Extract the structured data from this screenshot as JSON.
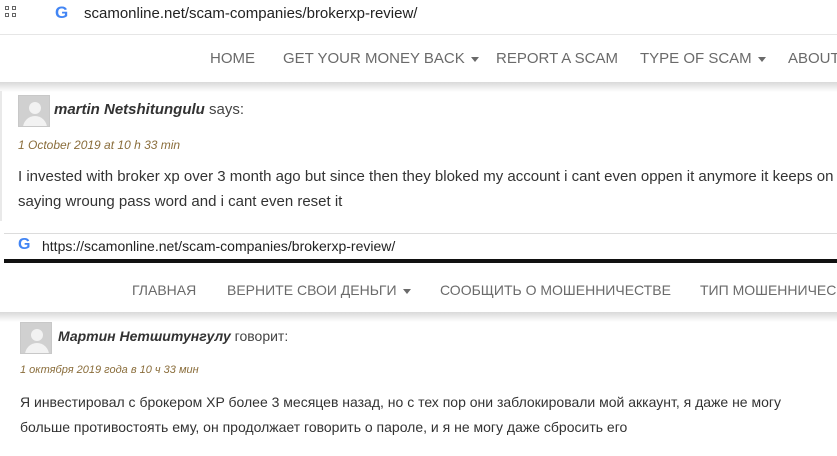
{
  "top": {
    "url": "scamonline.net/scam-companies/brokerxp-review/",
    "nav": [
      "HOME",
      "GET YOUR MONEY BACK",
      "REPORT A SCAM",
      "TYPE OF SCAM",
      "ABOUT"
    ],
    "comment": {
      "author": "martin Netshitungulu",
      "says": " says:",
      "date": "1 October 2019 at 10 h 33 min",
      "line1": "I invested with broker xp over 3 month ago but since then they bloked my account i cant even oppen it anymore it keeps on",
      "line2": "saying wroung pass word and i cant even reset it"
    }
  },
  "bottom": {
    "url": "https://scamonline.net/scam-companies/brokerxp-review/",
    "nav": [
      "ГЛАВНАЯ",
      "ВЕРНИТЕ СВОИ ДЕНЬГИ",
      "СООБЩИТЬ О МОШЕННИЧЕСТВЕ",
      "ТИП МОШЕННИЧЕС"
    ],
    "comment": {
      "author": "Мартин Нетшитунгулу",
      "says": " говорит:",
      "date": "1 октября 2019 года в 10 ч 33 мин",
      "line1": "Я инвестировал с брокером XP более 3 месяцев назад, но с тех пор они заблокировали мой аккаунт, я даже не могу",
      "line2": "больше противостоять ему, он продолжает говорить о пароле, и я не могу даже сбросить его"
    }
  },
  "icons": {
    "apps": "apps-grid-icon",
    "google": "google-g-icon",
    "avatar": "default-avatar-icon",
    "dropdown": "caret-down-icon"
  },
  "colors": {
    "date": "#8a6d3b",
    "nav_text": "#6a6a6a",
    "google_blue": "#4285f4"
  }
}
